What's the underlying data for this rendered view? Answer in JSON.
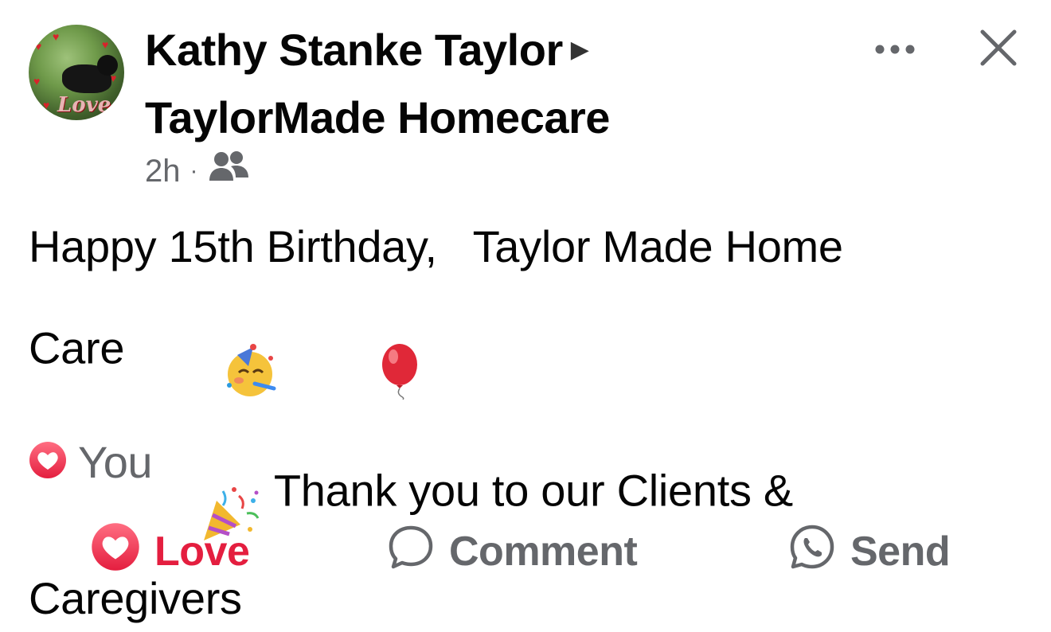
{
  "post": {
    "author": "Kathy Stanke Taylor",
    "group": "TaylorMade Homecare",
    "timestamp": "2h",
    "separator": "·",
    "audience_icon": "friends-icon",
    "avatar_caption": "Love",
    "text_line_1": "Happy 15th Birthday,   Taylor Made Home",
    "text_line_2_start": "Care",
    "text_line_2_end": " Thank you to our Clients &",
    "text_line_3": "Caregivers",
    "emojis": [
      "partying-face-icon",
      "balloon-icon",
      "party-popper-icon"
    ]
  },
  "reactions": {
    "icon": "heart-reaction-icon",
    "label": "You"
  },
  "actions": {
    "love_label": "Love",
    "comment_label": "Comment",
    "send_label": "Send"
  },
  "colors": {
    "love_red": "#e41e3f",
    "text": "#050505",
    "secondary": "#65676b"
  }
}
